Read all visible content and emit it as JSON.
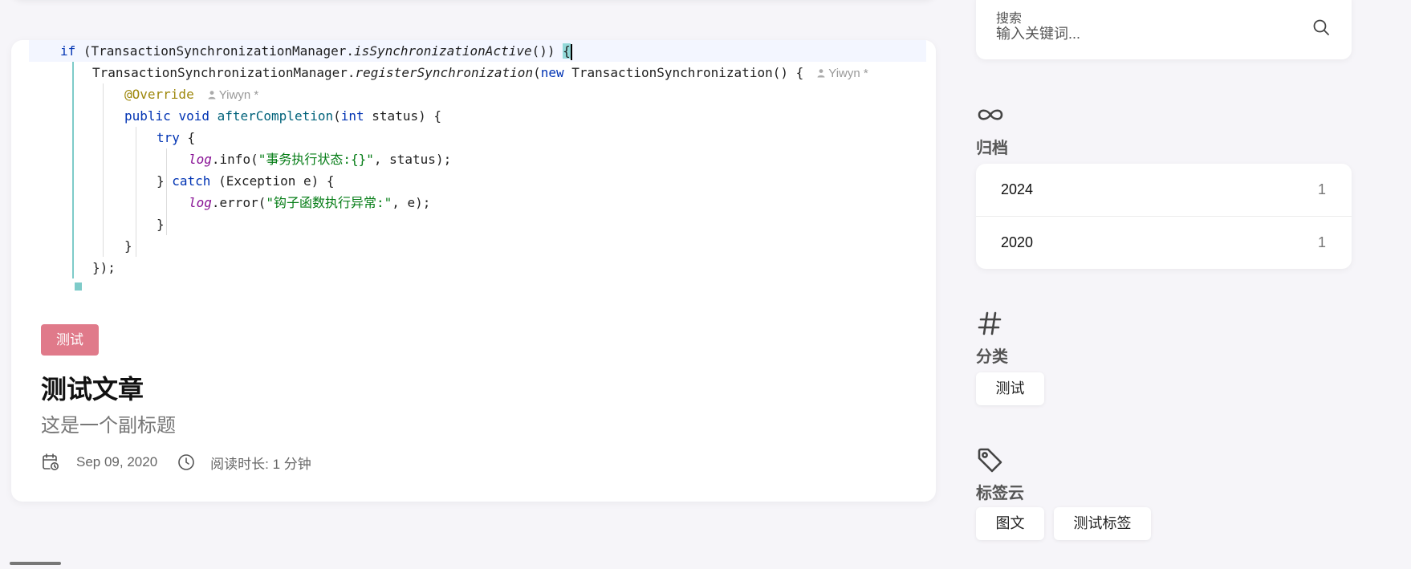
{
  "post": {
    "category_badge": "测试",
    "title": "测试文章",
    "subtitle": "这是一个副标题",
    "date": "Sep 09, 2020",
    "reading_time": "阅读时长: 1 分钟",
    "code": {
      "line1_if": "if",
      "line1_rest": " (TransactionSynchronizationManager.",
      "line1_method": "isSynchronizationActive",
      "line1_tail": "()) ",
      "line1_brace": "{",
      "line2_cls": "TransactionSynchronizationManager.",
      "line2_method": "registerSynchronization",
      "line2_paren": "(",
      "line2_new": "new",
      "line2_tail": " TransactionSynchronization() {",
      "line2_hint": "Yiwyn *",
      "line3_ann": "@Override",
      "line3_hint": "Yiwyn *",
      "line4_public": "public",
      "line4_void": "void",
      "line4_fn": "afterCompletion",
      "line4_paren": "(",
      "line4_int": "int",
      "line4_tail": " status) {",
      "line5_try": "try",
      "line5_tail": " {",
      "line6_log": "log",
      "line6_mid": ".info(",
      "line6_str": "\"事务执行状态:{}\"",
      "line6_tail": ", status);",
      "line7_open": "} ",
      "line7_catch": "catch",
      "line7_tail": " (Exception e) {",
      "line8_log": "log",
      "line8_mid": ".error(",
      "line8_str": "\"钩子函数执行异常:\"",
      "line8_tail": ", e);",
      "line9": "}",
      "line10": "}",
      "line11": "});"
    }
  },
  "sidebar": {
    "search": {
      "label": "搜索",
      "placeholder": "输入关键词..."
    },
    "archive": {
      "title": "归档",
      "items": [
        {
          "year": "2024",
          "count": "1"
        },
        {
          "year": "2020",
          "count": "1"
        }
      ]
    },
    "categories": {
      "title": "分类",
      "items": [
        "测试"
      ]
    },
    "tags": {
      "title": "标签云",
      "items": [
        "图文",
        "测试标签"
      ]
    }
  },
  "colors": {
    "badge": "#e07a8a",
    "page_background": "#f6f5f9",
    "code_keyword": "#0033b3",
    "code_string": "#067d17"
  },
  "icons": {
    "search": "search-icon",
    "archive": "infinity-icon",
    "categories": "hash-icon",
    "tags": "tag-icon",
    "date": "calendar-clock-icon",
    "reading_time": "clock-icon"
  }
}
